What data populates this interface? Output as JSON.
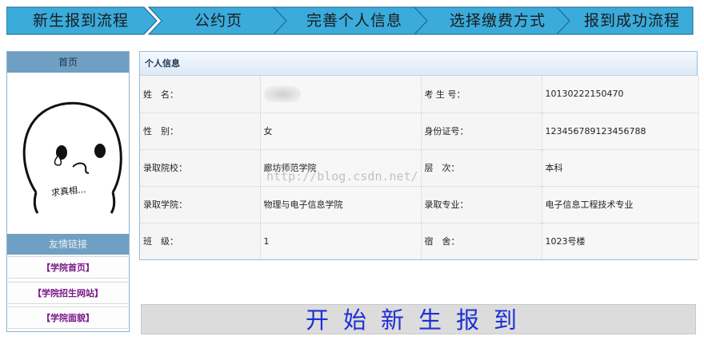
{
  "steps": [
    {
      "label": "新生报到流程"
    },
    {
      "label": "公约页"
    },
    {
      "label": "完善个人信息"
    },
    {
      "label": "选择缴费方式"
    },
    {
      "label": "报到成功流程"
    }
  ],
  "colors": {
    "step_fill": "#3aabdb",
    "step_border": "#1d5f86",
    "side_header": "#6f9fc2",
    "link_text": "#7a1a88",
    "start_text": "#1f2fd6"
  },
  "sidebar": {
    "home_label": "首页",
    "avatar_caption": "求真相...",
    "links_title": "友情链接",
    "links": [
      {
        "label": "【学院首页】"
      },
      {
        "label": "【学院招生网站】"
      },
      {
        "label": "【学院面貌】"
      }
    ]
  },
  "panel": {
    "title": "个人信息",
    "rows": [
      {
        "label1": "姓　名：",
        "value1": "",
        "label2": "考 生 号：",
        "value2": "10130222150470"
      },
      {
        "label1": "性　别：",
        "value1": "女",
        "label2": "身份证号：",
        "value2": "123456789123456788"
      },
      {
        "label1": "录取院校：",
        "value1": "廊坊师范学院",
        "label2": "层　次：",
        "value2": "本科"
      },
      {
        "label1": "录取学院：",
        "value1": "物理与电子信息学院",
        "label2": "录取专业：",
        "value2": "电子信息工程技术专业"
      },
      {
        "label1": "班　级：",
        "value1": "1",
        "label2": "宿　舍：",
        "value2": "1023号楼"
      }
    ]
  },
  "watermark": "http://blog.csdn.net/",
  "start_button": {
    "label": "开始新生报到"
  }
}
